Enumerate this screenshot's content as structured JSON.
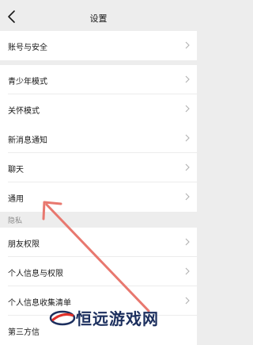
{
  "header": {
    "title": "设置"
  },
  "groups": [
    {
      "items": [
        {
          "label": "账号与安全"
        }
      ]
    },
    {
      "items": [
        {
          "label": "青少年模式"
        },
        {
          "label": "关怀模式"
        }
      ]
    },
    {
      "items": [
        {
          "label": "新消息通知"
        },
        {
          "label": "聊天"
        },
        {
          "label": "通用"
        }
      ]
    }
  ],
  "privacy": {
    "header": "隐私",
    "items": [
      {
        "label": "朋友权限"
      },
      {
        "label": "个人信息与权限"
      },
      {
        "label": "个人信息收集清单"
      },
      {
        "label": "第三方信"
      }
    ]
  },
  "watermark": {
    "text": "恒远游戏网"
  },
  "colors": {
    "annotation_arrow": "#e8786f",
    "background": "#ededed"
  }
}
